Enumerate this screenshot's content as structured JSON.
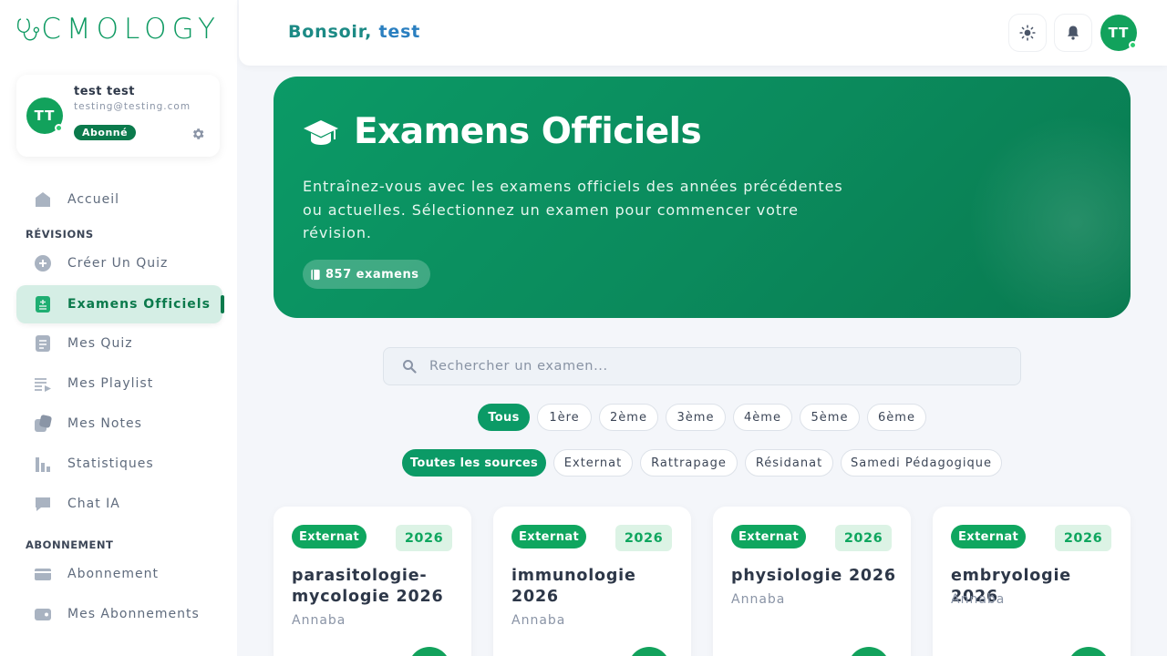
{
  "app": {
    "logo_text": "CMOLOGY"
  },
  "profile": {
    "initials": "TT",
    "name": "test test",
    "email": "testing@testing.com",
    "badge": "Abonné"
  },
  "nav": {
    "home": "Accueil",
    "section_revisions": "RÉVISIONS",
    "create_quiz": "Créer Un Quiz",
    "official_exams": "Examens Officiels",
    "my_quiz": "Mes Quiz",
    "my_playlist": "Mes Playlist",
    "my_notes": "Mes Notes",
    "statistics": "Statistiques",
    "chat_ai": "Chat IA",
    "section_subscription": "ABONNEMENT",
    "subscription": "Abonnement",
    "my_subscriptions": "Mes Abonnements"
  },
  "header": {
    "greeting": "Bonsoir, ",
    "username": "test",
    "avatar_initials": "TT"
  },
  "hero": {
    "title": "Examens Officiels",
    "description": "Entraînez-vous avec les examens officiels des années précédentes ou actuelles. Sélectionnez un examen pour commencer votre révision.",
    "count_label": "857 examens"
  },
  "search": {
    "placeholder": "Rechercher un examen..."
  },
  "year_filters": [
    "Tous",
    "1ère",
    "2ème",
    "3ème",
    "4ème",
    "5ème",
    "6ème"
  ],
  "source_filters": [
    "Toutes les sources",
    "Externat",
    "Rattrapage",
    "Résidanat",
    "Samedi Pédagogique"
  ],
  "exams": [
    {
      "source": "Externat",
      "year": "2026",
      "title": "parasitologie-mycologie 2026",
      "location": "Annaba"
    },
    {
      "source": "Externat",
      "year": "2026",
      "title": "immunologie 2026",
      "location": "Annaba"
    },
    {
      "source": "Externat",
      "year": "2026",
      "title": "physiologie 2026",
      "location": "Annaba"
    },
    {
      "source": "Externat",
      "year": "2026",
      "title": "embryologie 2026",
      "location": "Annaba"
    }
  ],
  "colors": {
    "brand": "#0b9a66",
    "accent_dark": "#0b7a4c",
    "greeting": "#1c8a85"
  }
}
